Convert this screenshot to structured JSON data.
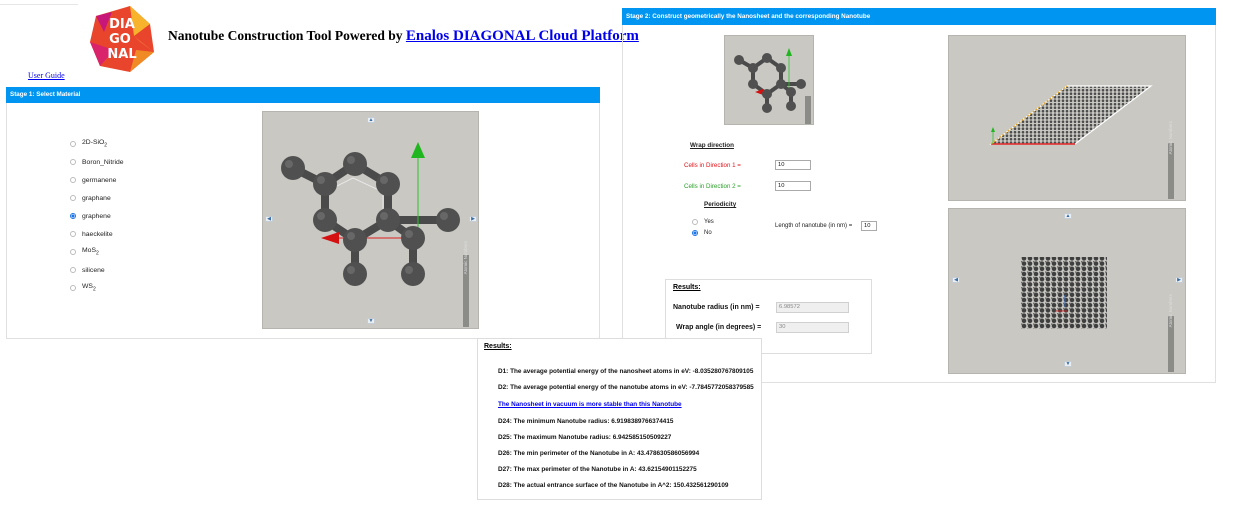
{
  "header": {
    "logo_text": [
      "DIA",
      "GO",
      "NAL"
    ],
    "title_prefix": "Nanotube Construction Tool Powered by",
    "title_link": "Enalos DIAGONAL Cloud Platform",
    "user_guide": "User Guide"
  },
  "stage1": {
    "title": "Stage 1: Select Material",
    "materials": [
      {
        "base": "2D-SiO",
        "sub": "2",
        "selected": false
      },
      {
        "base": "Boron_Nitride",
        "sub": "",
        "selected": false
      },
      {
        "base": "germanene",
        "sub": "",
        "selected": false
      },
      {
        "base": "graphane",
        "sub": "",
        "selected": false
      },
      {
        "base": "graphene",
        "sub": "",
        "selected": true
      },
      {
        "base": "haeckelite",
        "sub": "",
        "selected": false
      },
      {
        "base": "MoS",
        "sub": "2",
        "selected": false
      },
      {
        "base": "silicene",
        "sub": "",
        "selected": false
      },
      {
        "base": "WS",
        "sub": "2",
        "selected": false
      }
    ],
    "viewer_side_label": "Atomic Numbers"
  },
  "stage2": {
    "title": "Stage 2: Construct geometrically the Nanosheet and the corresponding Nanotube",
    "wrap_direction": "Wrap direction",
    "cells_dir1_label": "Cells in Direction 1 =",
    "cells_dir1_value": "10",
    "cells_dir2_label": "Cells in Direction 2 =",
    "cells_dir2_value": "10",
    "periodicity": "Periodicity",
    "yes": "Yes",
    "no": "No",
    "length_label": "Length of nanotube (in nm) =",
    "length_value": "10",
    "results_title": "Results:",
    "radius_label": "Nanotube radius (in nm) =",
    "radius_value": "6.98572",
    "angle_label": "Wrap angle (in degrees) =",
    "angle_value": "30",
    "viewer_side_label": "Atomic Numbers"
  },
  "results": {
    "title": "Results:",
    "d1": "D1: The average potential energy of the nanosheet atoms in eV: -8.035280767809105",
    "d2": "D2: The average potential energy of the nanotube atoms in eV: -7.7845772058379585",
    "stability_link": "The Nanosheet in vacuum is more stable than this Nanotube",
    "d24": "D24: The minimum Nanotube radius: 6.9198389766374415",
    "d25": "D25: The maximum Nanotube radius: 6.942585150509227",
    "d26": "D26: The min perimeter of the Nanotube in A: 43.478630586056994",
    "d27": "D27: The max perimeter of the Nanotube in A: 43.62154901152275",
    "d28": "D28: The actual entrance surface of the Nanotube in A^2: 150.432561290109"
  },
  "colors": {
    "stage_bar": "#0095f0",
    "viewer_bg": "#c9c8c3",
    "atom": "#555555",
    "red_label": "#e0131a",
    "green_label": "#2aa02a",
    "link": "#0000ee"
  }
}
